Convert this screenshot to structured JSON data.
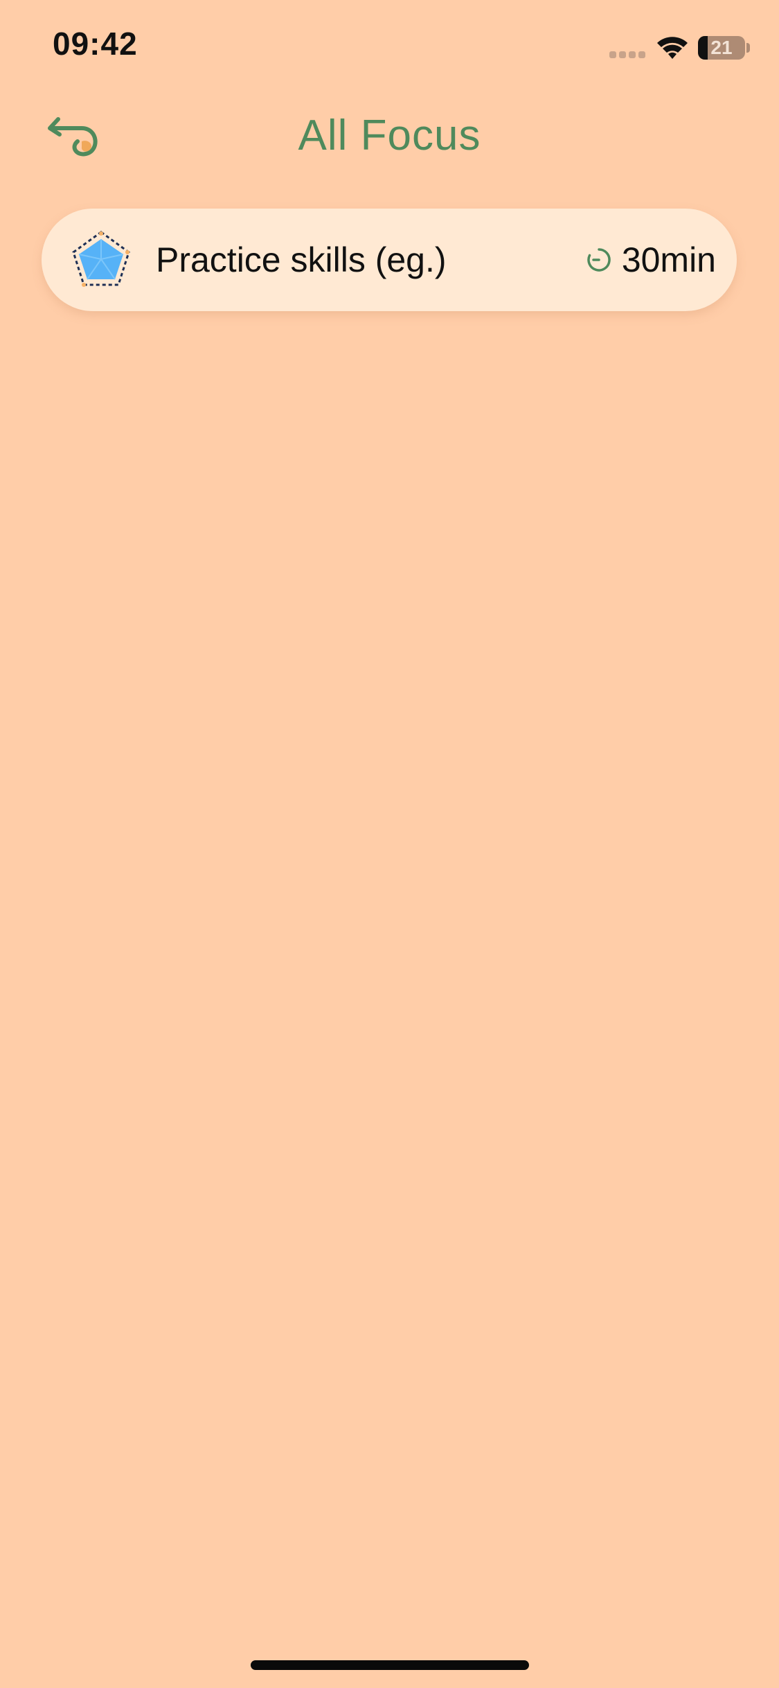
{
  "status_bar": {
    "time": "09:42",
    "battery_level": "21",
    "battery_fraction": 0.21
  },
  "header": {
    "title": "All Focus",
    "back_icon": "curled-return-arrow-icon"
  },
  "focus_list": [
    {
      "title": "Practice skills (eg.)",
      "duration": "30min",
      "icon": "pentagon-radar-icon",
      "timer_icon": "timer-icon"
    }
  ],
  "colors": {
    "background": "#FFCDA8",
    "card_background": "#FFE9D3",
    "accent_green": "#4F8A5C",
    "text": "#111111",
    "icon_blue": "#56B2F7"
  }
}
